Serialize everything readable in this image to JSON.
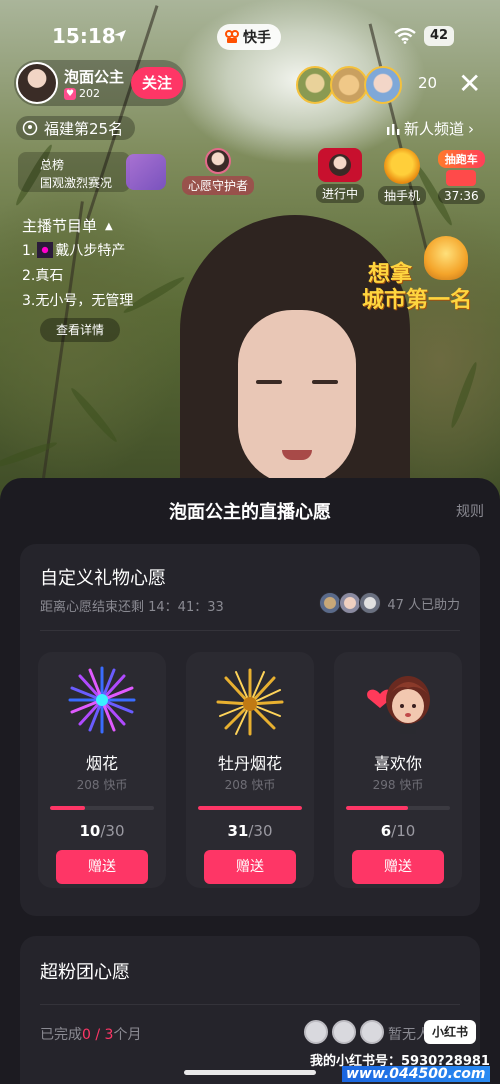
{
  "status_bar": {
    "time": "15:18",
    "app_pill": "快手",
    "battery": "42"
  },
  "streamer": {
    "name": "泡面公主",
    "likes": "202",
    "follow_label": "关注"
  },
  "viewers": {
    "count": "20"
  },
  "rank": {
    "label": "福建第25名"
  },
  "channel": {
    "label": "新人频道"
  },
  "board": {
    "line1": "总榜",
    "line2": "国观激烈赛况"
  },
  "activities": [
    {
      "label": "心愿守护者",
      "icon": "wish-guardian-icon"
    },
    {
      "label": "进行中",
      "icon": "in-progress-icon"
    },
    {
      "label": "抽手机",
      "icon": "phone-lottery-icon"
    },
    {
      "label": "37:36",
      "badge": "抽跑车",
      "icon": "sports-car-lottery-icon"
    }
  ],
  "program": {
    "title": "主播节目单",
    "items": [
      "1.",
      "戴八步特产",
      "2.真石",
      "3.无小号，无管理"
    ],
    "detail_button": "查看详情"
  },
  "promo": {
    "line1": "想拿",
    "line2": "城市第一名"
  },
  "sheet": {
    "title": "泡面公主的直播心愿",
    "rules": "规则",
    "custom_wish": {
      "title": "自定义礼物心愿",
      "countdown": "距离心愿结束还剩 14：41：33",
      "helpers": "47 人已助力",
      "gifts": [
        {
          "name": "烟花",
          "price": "208 快币",
          "current": "10",
          "total": "30",
          "progress": 0.333,
          "send": "赠送",
          "icon": "fireworks-icon"
        },
        {
          "name": "牡丹烟花",
          "price": "208 快币",
          "current": "31",
          "total": "30",
          "progress": 1.0,
          "send": "赠送",
          "icon": "peony-fireworks-icon"
        },
        {
          "name": "喜欢你",
          "price": "298 快币",
          "current": "6",
          "total": "10",
          "progress": 0.6,
          "send": "赠送",
          "icon": "like-you-icon"
        }
      ]
    },
    "fan_wish": {
      "title": "超粉团心愿",
      "done_prefix": "已完成",
      "done_current": "0",
      "done_sep": "/",
      "done_total": "3",
      "done_suffix": "个月",
      "nobody": "暂无人"
    }
  },
  "watermark": {
    "badge": "小红书",
    "line1": "我的小红书号：5930?28981",
    "line2": "www.044500.com"
  },
  "colors": {
    "accent": "#fe3666",
    "sheet_bg": "#1c1b21",
    "card_bg": "#25242b",
    "muted": "#8a8a92"
  }
}
